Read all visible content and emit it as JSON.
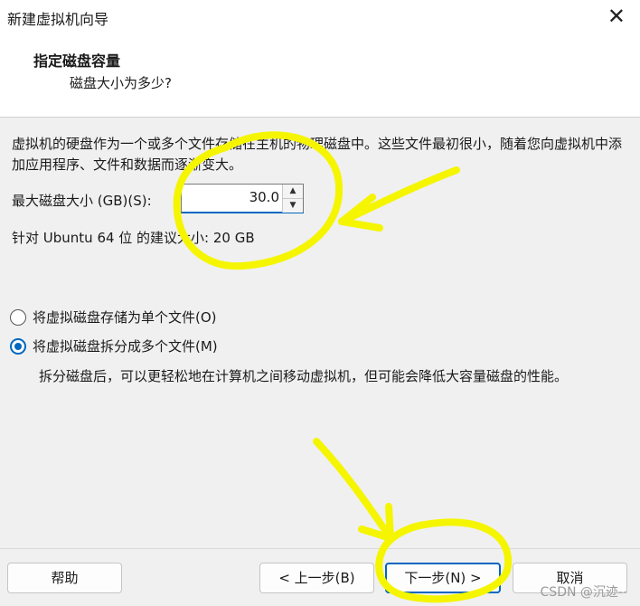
{
  "window": {
    "title": "新建虚拟机向导",
    "close_icon": "close-icon"
  },
  "header": {
    "title": "指定磁盘容量",
    "subtitle": "磁盘大小为多少?"
  },
  "description": "虚拟机的硬盘作为一个或多个文件存储在主机的物理磁盘中。这些文件最初很小，随着您向虚拟机中添加应用程序、文件和数据而逐渐变大。",
  "disk_size": {
    "label": "最大磁盘大小 (GB)(S):",
    "value": "30.0"
  },
  "recommendation": "针对 Ubuntu 64 位 的建议大小: 20 GB",
  "options": [
    {
      "label": "将虚拟磁盘存储为单个文件(O)",
      "selected": false
    },
    {
      "label": "将虚拟磁盘拆分成多个文件(M)",
      "selected": true
    }
  ],
  "split_note": "拆分磁盘后，可以更轻松地在计算机之间移动虚拟机，但可能会降低大容量磁盘的性能。",
  "buttons": {
    "help": "帮助",
    "back": "< 上一步(B)",
    "next": "下一步(N) >",
    "cancel": "取消"
  },
  "watermark": "CSDN @沉迹--",
  "colors": {
    "accent": "#0067c0",
    "annotation": "#f5f500"
  }
}
